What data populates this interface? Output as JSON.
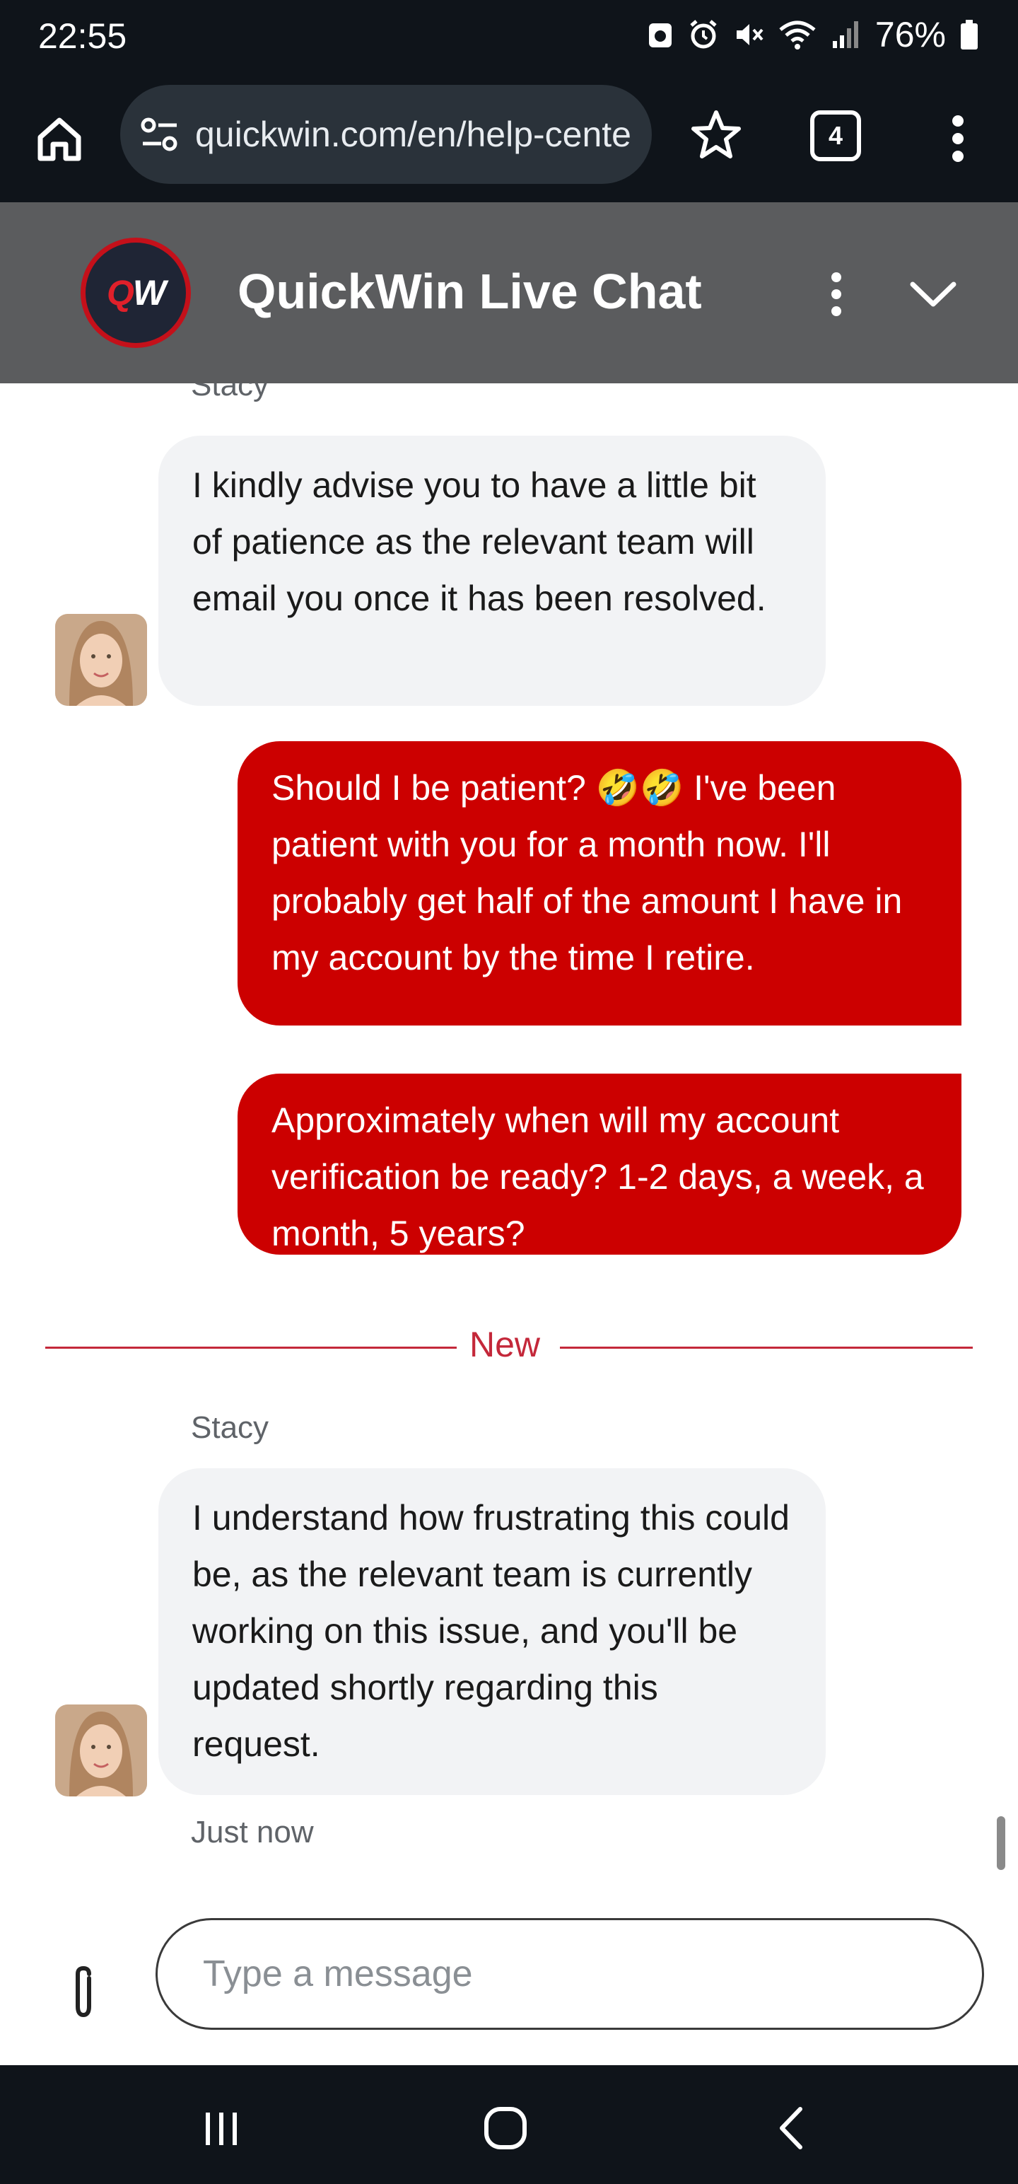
{
  "status_bar": {
    "time": "22:55",
    "battery": "76%"
  },
  "browser": {
    "url": "quickwin.com/en/help-center",
    "tab_count": "4"
  },
  "chat_header": {
    "logo_letters": "QW",
    "title": "QuickWin Live Chat"
  },
  "messages": [
    {
      "type": "incoming",
      "sender": "Stacy",
      "text": "I kindly advise you to have a little bit of patience as the relevant team will email you once it has been resolved."
    },
    {
      "type": "outgoing",
      "text": "Should I be patient?  🤣🤣 I've been patient with you for a month now. I'll probably get half of the amount I have in my account by the time I retire."
    },
    {
      "type": "outgoing",
      "text": "Approximately when will my account verification be ready? 1-2 days, a week, a month, 5 years?"
    },
    {
      "type": "incoming",
      "sender": "Stacy",
      "text": "I understand how frustrating this could be, as the relevant team is currently working on this issue, and you'll be updated shortly regarding this request.",
      "timestamp": "Just now"
    }
  ],
  "divider": {
    "label": "New"
  },
  "composer": {
    "placeholder": "Type a message"
  },
  "colors": {
    "brand_red": "#cc0000",
    "header_gray": "#5b5c5e",
    "incoming_bubble": "#f2f3f5",
    "divider": "#c4283a"
  },
  "icons": {
    "home": "home-icon",
    "site_settings": "tune-icon",
    "bookmark": "star-icon",
    "menu": "more-vert-icon",
    "collapse": "chevron-down-icon",
    "attach": "paperclip-icon",
    "nav_recents": "recents-icon",
    "nav_home": "nav-home-icon",
    "nav_back": "back-icon"
  }
}
